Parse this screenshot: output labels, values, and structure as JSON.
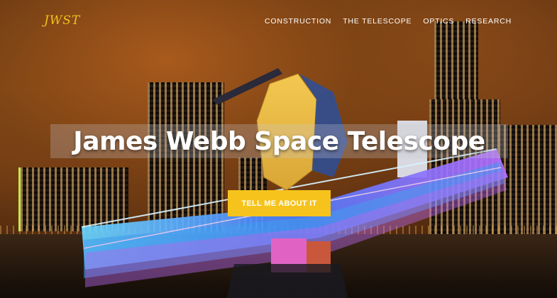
{
  "brand": {
    "logo": "JWST"
  },
  "nav": {
    "items": [
      {
        "label": "CONSTRUCTION"
      },
      {
        "label": "THE TELESCOPE"
      },
      {
        "label": "OPTICS"
      },
      {
        "label": "RESEARCH"
      }
    ]
  },
  "hero": {
    "title": "James Webb Space Telescope",
    "cta_label": "TELL ME ABOUT IT"
  },
  "colors": {
    "accent": "#f6c31c",
    "logo": "#f2c21b"
  }
}
